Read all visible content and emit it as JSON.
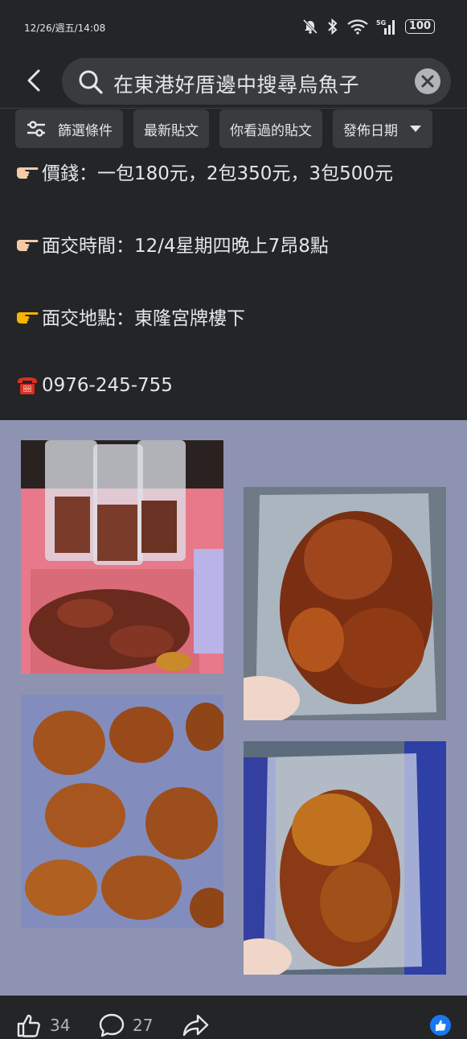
{
  "status_bar": {
    "time": "12/26/週五/14:08",
    "battery": "100",
    "network": "5G"
  },
  "search": {
    "query": "在東港好厝邊中搜尋烏魚子"
  },
  "filters": [
    {
      "label": "篩選條件"
    },
    {
      "label": "最新貼文"
    },
    {
      "label": "你看過的貼文"
    },
    {
      "label": "發佈日期"
    }
  ],
  "post": {
    "lines": [
      "價錢：一包180元，2包350元，3包500元",
      "面交時間：12/4星期四晚上7昂8點",
      "面交地點：東隆宮牌樓下",
      "0976-245-755"
    ]
  },
  "reactions": {
    "likes": "34",
    "comments": "27"
  },
  "colors": {
    "background": "#242526",
    "chip": "#3a3b3c",
    "text": "#e4e6eb",
    "photo_backdrop": "#8e93b2",
    "accent": "#1877f2"
  }
}
